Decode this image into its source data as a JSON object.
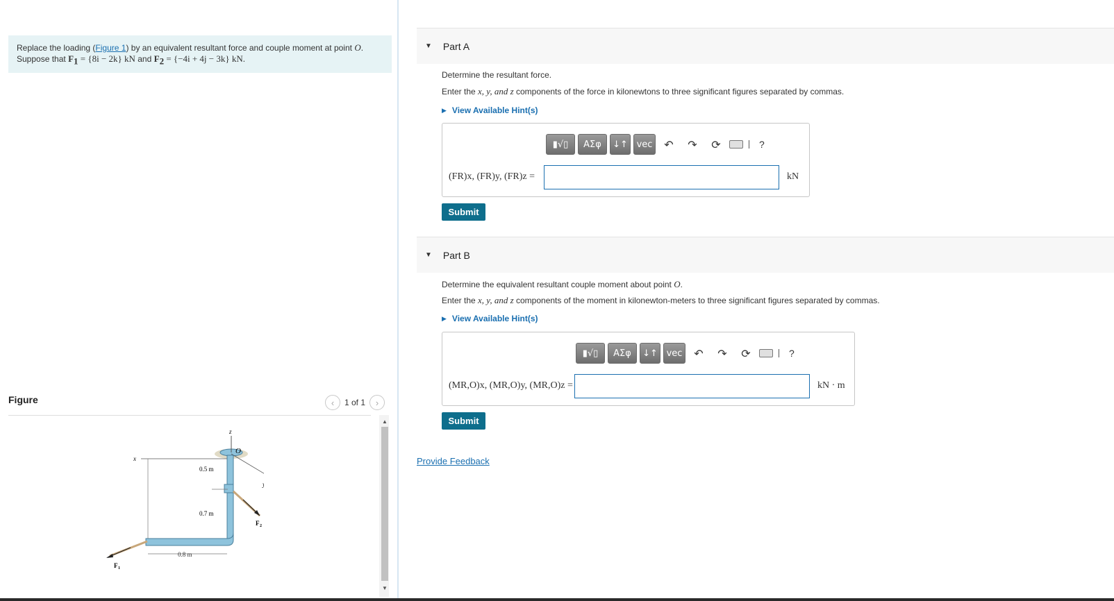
{
  "problem": {
    "prefix": "Replace the loading (",
    "figure_link": "Figure 1",
    "middle": ") by an equivalent resultant force and couple moment at point ",
    "point": "O",
    "line2_prefix": "Suppose that ",
    "F1_label": "F",
    "F1_sub": "1",
    "F1_value": " = {8i − 2k} kN",
    "and": " and ",
    "F2_label": "F",
    "F2_sub": "2",
    "F2_value": " = {−4i + 4j − 3k} kN."
  },
  "figure": {
    "title": "Figure",
    "pager_text": "1 of 1",
    "labels": {
      "z": "z",
      "x": "x",
      "y": "y",
      "O": "O",
      "d05": "0.5 m",
      "d07": "0.7 m",
      "d08": "0.8 m",
      "F1": "F",
      "F1_sub": "1",
      "F2": "F",
      "F2_sub": "2"
    }
  },
  "partA": {
    "header": "Part A",
    "q1": "Determine the resultant force.",
    "q2_prefix": "Enter the ",
    "q2_vars": "x, y, and z",
    "q2_suffix": " components of the force in kilonewtons to three significant figures separated by commas.",
    "hint": "View Available Hint(s)",
    "eq_label": "(FR)x, (FR)y, (FR)z =",
    "input_value": "",
    "unit": "kN",
    "submit": "Submit"
  },
  "partB": {
    "header": "Part B",
    "q1_prefix": "Determine the equivalent resultant couple moment about point ",
    "q1_point": "O",
    "q1_suffix": ".",
    "q2_prefix": "Enter the ",
    "q2_vars": "x, y, and z",
    "q2_suffix": " components of the moment in kilonewton-meters to three significant figures separated by commas.",
    "hint": "View Available Hint(s)",
    "eq_label": "(MR,O)x, (MR,O)y, (MR,O)z =",
    "input_value": "",
    "unit": "kN · m",
    "submit": "Submit"
  },
  "toolbar": {
    "templates": "▮√▯",
    "greek": "ΑΣφ",
    "arrows": "↓↑",
    "vec": "vec",
    "undo": "↶",
    "redo": "↷",
    "reset": "⟳",
    "help": "?"
  },
  "feedback": "Provide Feedback"
}
